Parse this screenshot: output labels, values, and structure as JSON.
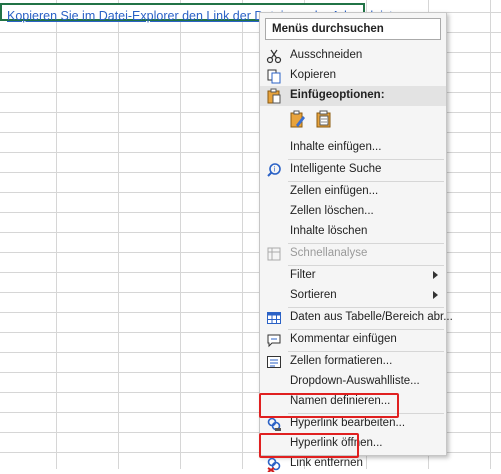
{
  "cell": {
    "text": "Kopieren Sie im Datei-Explorer den Link der Datei aus der Adressleiste"
  },
  "menu": {
    "search_label": "Menüs durchsuchen",
    "items": {
      "cut": "Ausschneiden",
      "copy": "Kopieren",
      "paste_options": "Einfügeoptionen:",
      "paste_special": "Inhalte einfügen...",
      "smart_lookup": "Intelligente Suche",
      "insert_cells": "Zellen einfügen...",
      "delete_cells": "Zellen löschen...",
      "clear_contents": "Inhalte löschen",
      "quick_analysis": "Schnellanalyse",
      "filter": "Filter",
      "sort": "Sortieren",
      "table_range": "Daten aus Tabelle/Bereich abr...",
      "insert_comment": "Kommentar einfügen",
      "format_cells": "Zellen formatieren...",
      "dropdown": "Dropdown-Auswahlliste...",
      "define_name": "Namen definieren...",
      "edit_hyperlink": "Hyperlink bearbeiten...",
      "open_hyperlink": "Hyperlink öffnen...",
      "remove_link": "Link entfernen"
    }
  },
  "colors": {
    "accent": "#217346",
    "highlight": "#e02020",
    "link": "#2b62c6"
  }
}
